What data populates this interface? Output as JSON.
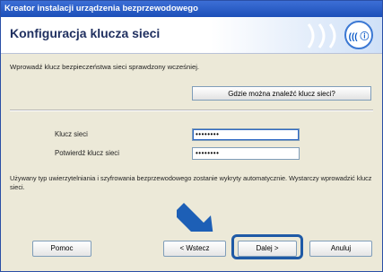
{
  "window": {
    "title": "Kreator instalacji urządzenia bezprzewodowego"
  },
  "header": {
    "title": "Konfiguracja klucza sieci",
    "logo_glyph": "((( ⓘ"
  },
  "content": {
    "instruction": "Wprowadź klucz bezpieczeństwa sieci sprawdzony wcześniej.",
    "help_button_label": "Gdzie można znaleźć klucz sieci?",
    "network_key_label": "Klucz sieci",
    "network_key_value": "••••••••",
    "confirm_key_label": "Potwierdź klucz sieci",
    "confirm_key_value": "••••••••",
    "info_text": "Używany typ uwierzytelniania i szyfrowania bezprzewodowego zostanie wykryty automatycznie. Wystarczy wprowadzić klucz sieci."
  },
  "footer": {
    "help_label": "Pomoc",
    "back_label": "< Wstecz",
    "next_label": "Dalej >",
    "cancel_label": "Anuluj"
  },
  "colors": {
    "titlebar": "#1c4fb8",
    "highlight": "#1f5aa6",
    "arrow": "#1d5fb6"
  }
}
